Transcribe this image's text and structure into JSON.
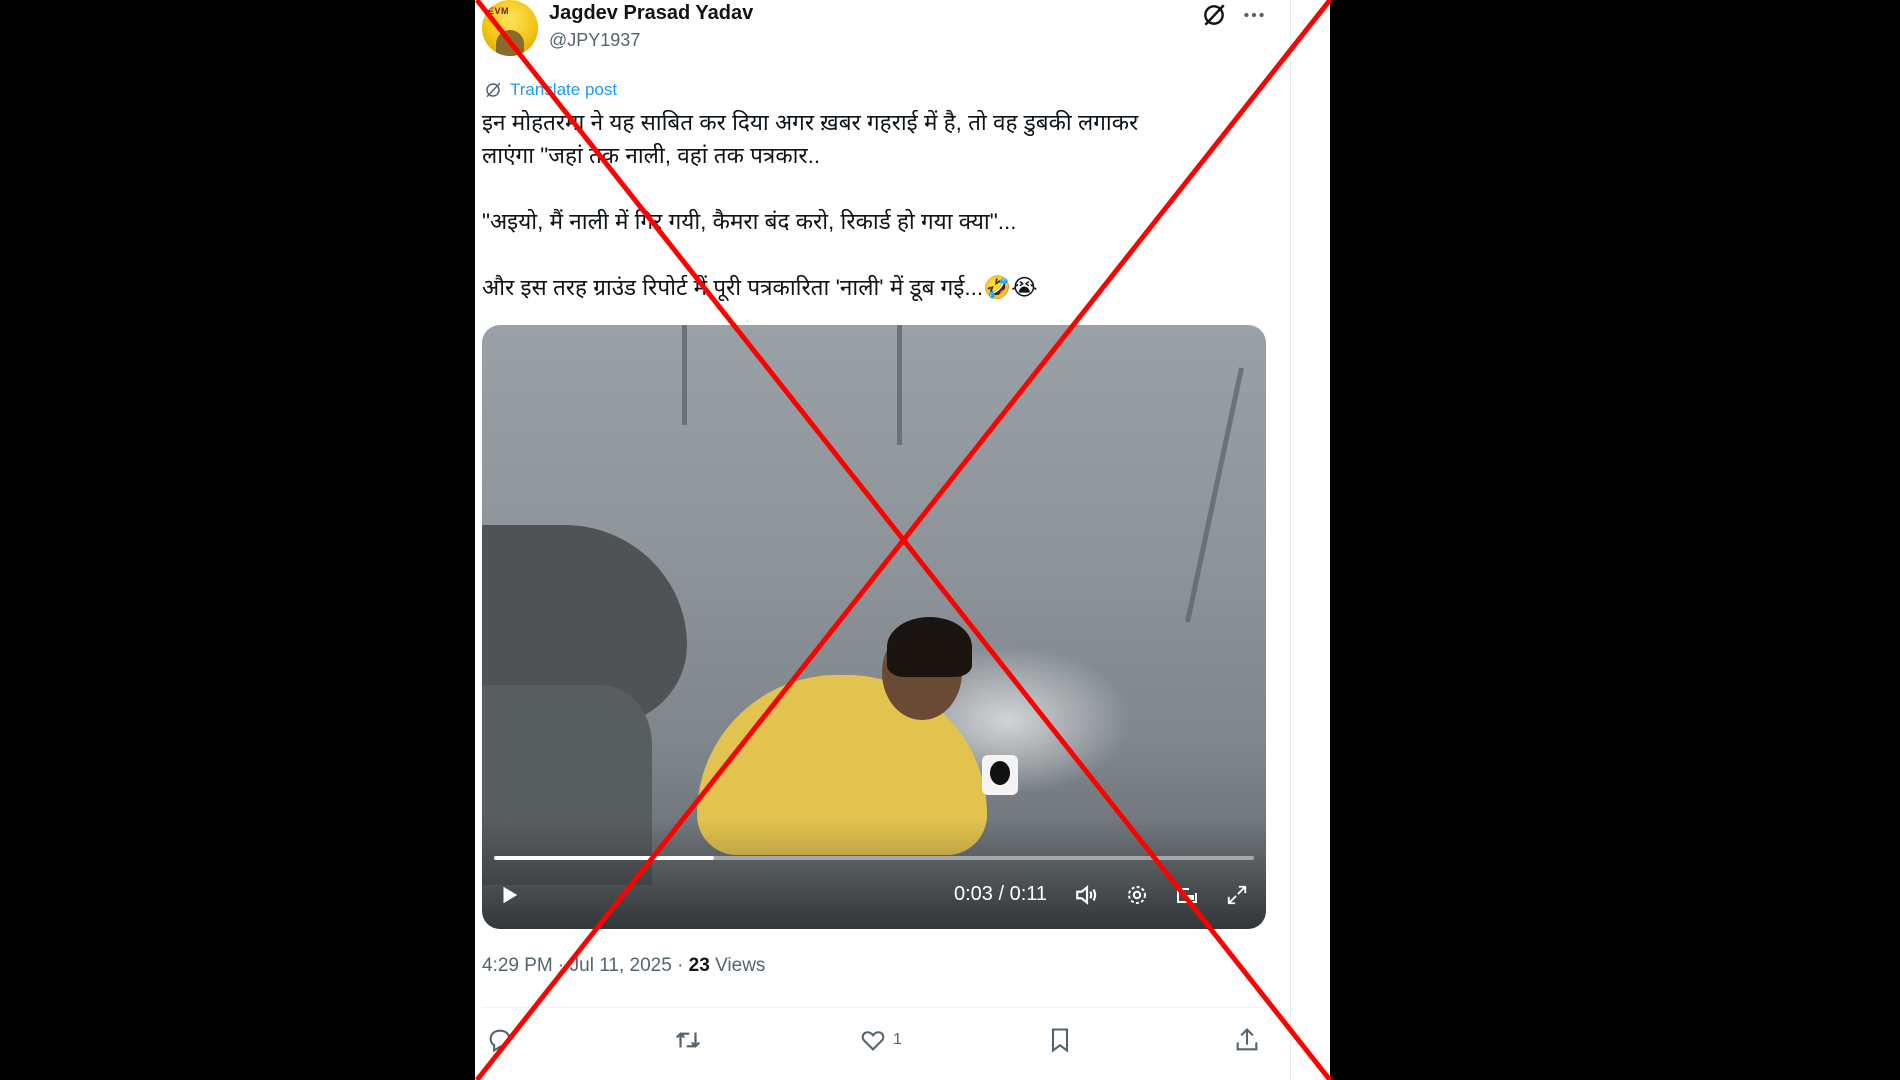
{
  "colors": {
    "accent": "#1d9bf0",
    "text": "#0f1419",
    "muted": "#536471",
    "overlay_x": "#ff0000"
  },
  "author": {
    "name": "Jagdev Prasad Yadav",
    "handle": "@JPY1937",
    "avatar_text": "EVM"
  },
  "header_icons": [
    "grok-icon",
    "more-icon"
  ],
  "translate_label": "Translate post",
  "post_text": {
    "line1": "इन मोहतरमा ने यह साबित कर दिया अगर ख़बर गहराई में है, तो वह डुबकी लगाकर",
    "line2": "लाएंगा \"जहां तक नाली, वहां तक पत्रकार..",
    "line3": "\"अइयो, मैं नाली में गिर गयी, कैमरा बंद करो, रिकार्ड हो गया क्या\"...",
    "line4": "और इस तरह ग्राउंड रिपोर्ट में पूरी पत्रकारिता 'नाली' में डूब गई...🤣😭"
  },
  "video": {
    "time": "0:03 / 0:11",
    "progress": 0.29
  },
  "meta": {
    "time": "4:29 PM",
    "date": "Jul 11, 2025",
    "views_count": "23",
    "views_label": "Views"
  },
  "actions": {
    "like_count": "1"
  }
}
